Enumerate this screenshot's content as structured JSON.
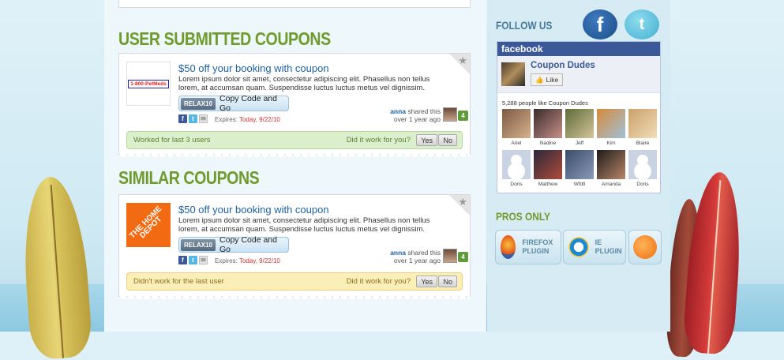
{
  "sections": {
    "user_submitted_title": "USER SUBMITTED COUPONS",
    "similar_title": "SIMILAR COUPONS"
  },
  "coupons": [
    {
      "logo_text": "1-800-PetMeds",
      "title": "$50 off your booking with coupon",
      "description": "Lorem ipsum dolor sit amet, consectetur adipiscing elit. Phasellus non tellus lorem, at accumsan quam. Suspendisse luctus luctus metus vel dignissim.",
      "code": "RELAX10",
      "copy_label": "Copy Code and Go",
      "expires_label": "Expires:",
      "expires_date": "Today, 9/22/10",
      "shared_user": "anna",
      "shared_text": "shared this",
      "shared_when": "over 1 year ago",
      "shared_count": "4",
      "status_text": "Worked for last 3 users",
      "question": "Did it work for you?",
      "yes": "Yes",
      "no": "No"
    },
    {
      "logo_text": "THE HOME DEPOT",
      "title": "$50 off your booking with coupon",
      "description": "Lorem ipsum dolor sit amet, consectetur adipiscing elit. Phasellus non tellus lorem, at accumsan quam. Suspendisse luctus luctus metus vel dignissim.",
      "code": "RELAX10",
      "copy_label": "Copy Code and Go",
      "expires_label": "Expires:",
      "expires_date": "Today, 9/22/10",
      "shared_user": "anna",
      "shared_text": "shared this",
      "shared_when": "over 1 year ago",
      "shared_count": "4",
      "status_text": "Didn't work for the last user",
      "question": "Did it work for you?",
      "yes": "Yes",
      "no": "No"
    }
  ],
  "sidebar": {
    "follow_us": "FOLLOW US",
    "facebook_header": "facebook",
    "page_name": "Coupon Dudes",
    "like_label": "Like",
    "likes_count": "5,288 people like Coupon Dudes",
    "faces": [
      "Ariel",
      "Nadine",
      "Jeff",
      "Kim",
      "Blaire",
      "Doris",
      "Matthew",
      "Wfdtl",
      "Amanda",
      "Doris"
    ],
    "pros_only": "PROS ONLY",
    "firefox_plugin": "FIREFOX PLUGIN",
    "ie_plugin": "IE PLUGIN"
  },
  "colors": {
    "accent_green": "#6f9b2b",
    "link_blue": "#1d62a8",
    "facebook_blue": "#3b5998"
  }
}
